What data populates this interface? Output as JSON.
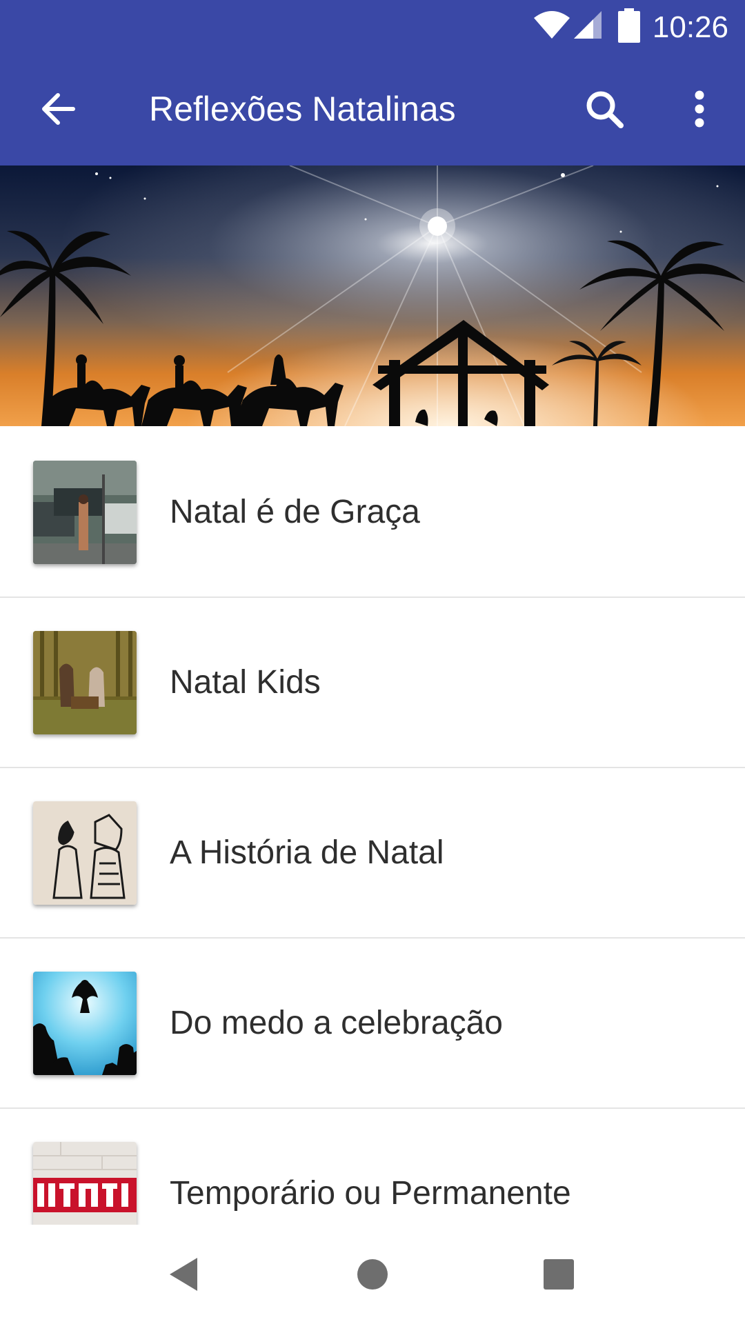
{
  "status_bar": {
    "time": "10:26",
    "icons": [
      "wifi-icon",
      "cell-signal-icon",
      "battery-icon"
    ]
  },
  "toolbar": {
    "title": "Reflexões Natalinas",
    "back_icon": "arrow-back-icon",
    "search_icon": "search-icon",
    "more_icon": "more-vert-icon"
  },
  "banner": {
    "image": "nativity-scene-banner"
  },
  "list": {
    "items": [
      {
        "title": "Natal é de Graça",
        "thumbnail": "street-scene-thumbnail"
      },
      {
        "title": "Natal Kids",
        "thumbnail": "manger-animation-thumbnail"
      },
      {
        "title": "A História de Natal",
        "thumbnail": "joseph-mary-drawing-thumbnail"
      },
      {
        "title": "Do medo a celebração",
        "thumbnail": "angel-shepherds-thumbnail"
      },
      {
        "title": "Temporário ou Permanente",
        "thumbnail": "natal-sign-thumbnail"
      }
    ]
  },
  "nav_bar": {
    "icons": [
      "nav-back-icon",
      "nav-home-icon",
      "nav-recents-icon"
    ]
  },
  "colors": {
    "primary": "#3a48a6",
    "text": "#2e2e2e",
    "divider": "#e4e4e4"
  }
}
